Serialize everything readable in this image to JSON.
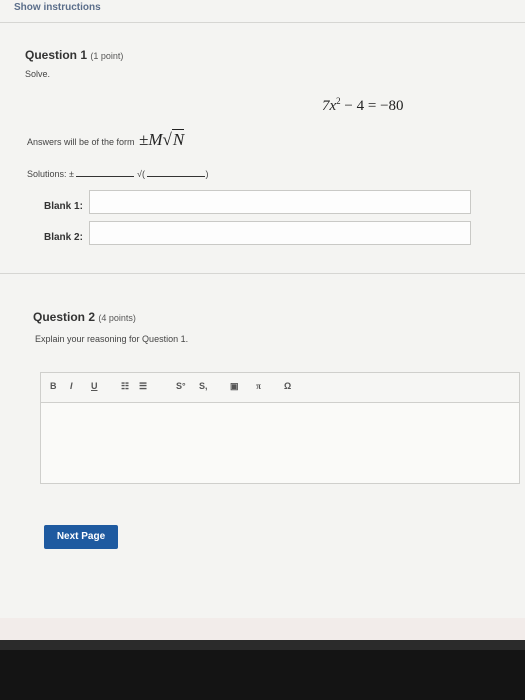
{
  "header": {
    "show_instructions": "Show instructions"
  },
  "question1": {
    "title": "Question 1",
    "points": "(1 point)",
    "prompt": "Solve.",
    "equation": {
      "left": "7x",
      "exp": "2",
      "rest": " − 4 = −80"
    },
    "form_text": "Answers will be of the form",
    "form_math": {
      "pm": "±M",
      "radical": "√",
      "radicand": "N"
    },
    "solutions_label": "Solutions: ±",
    "solutions_sqrt": "√(",
    "solutions_close": ")",
    "blank1_label": "Blank 1:",
    "blank1_value": "",
    "blank2_label": "Blank 2:",
    "blank2_value": ""
  },
  "question2": {
    "title": "Question 2",
    "points": "(4 points)",
    "prompt": "Explain your reasoning for Question 1.",
    "toolbar": {
      "bold": "B",
      "italic": "I",
      "underline": "U",
      "bullet_list": "☷",
      "numbered_list": "☰",
      "superscript": "S°",
      "subscript": "S,",
      "image": "▣",
      "pi": "π",
      "omega": "Ω"
    },
    "editor_value": ""
  },
  "footer": {
    "next_page_label": "Next Page"
  }
}
